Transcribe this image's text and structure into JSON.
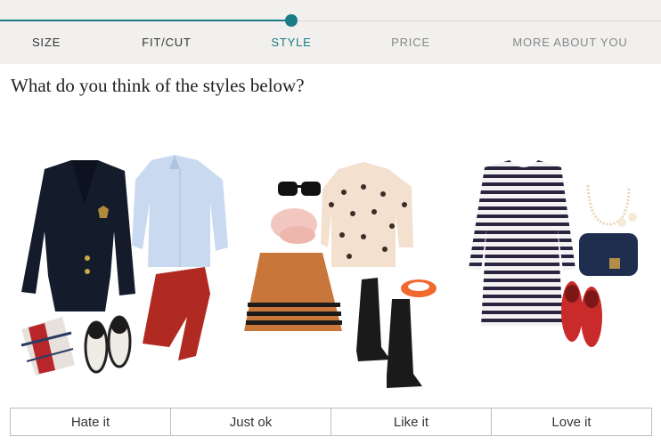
{
  "progress": {
    "steps": [
      "SIZE",
      "FIT/CUT",
      "STYLE",
      "PRICE",
      "MORE ABOUT YOU"
    ],
    "active_step": "STYLE",
    "accent_color": "#1b7b84"
  },
  "question": "What do you think of the styles below?",
  "ratings": [
    "Hate it",
    "Just ok",
    "Like it",
    "Love it"
  ]
}
